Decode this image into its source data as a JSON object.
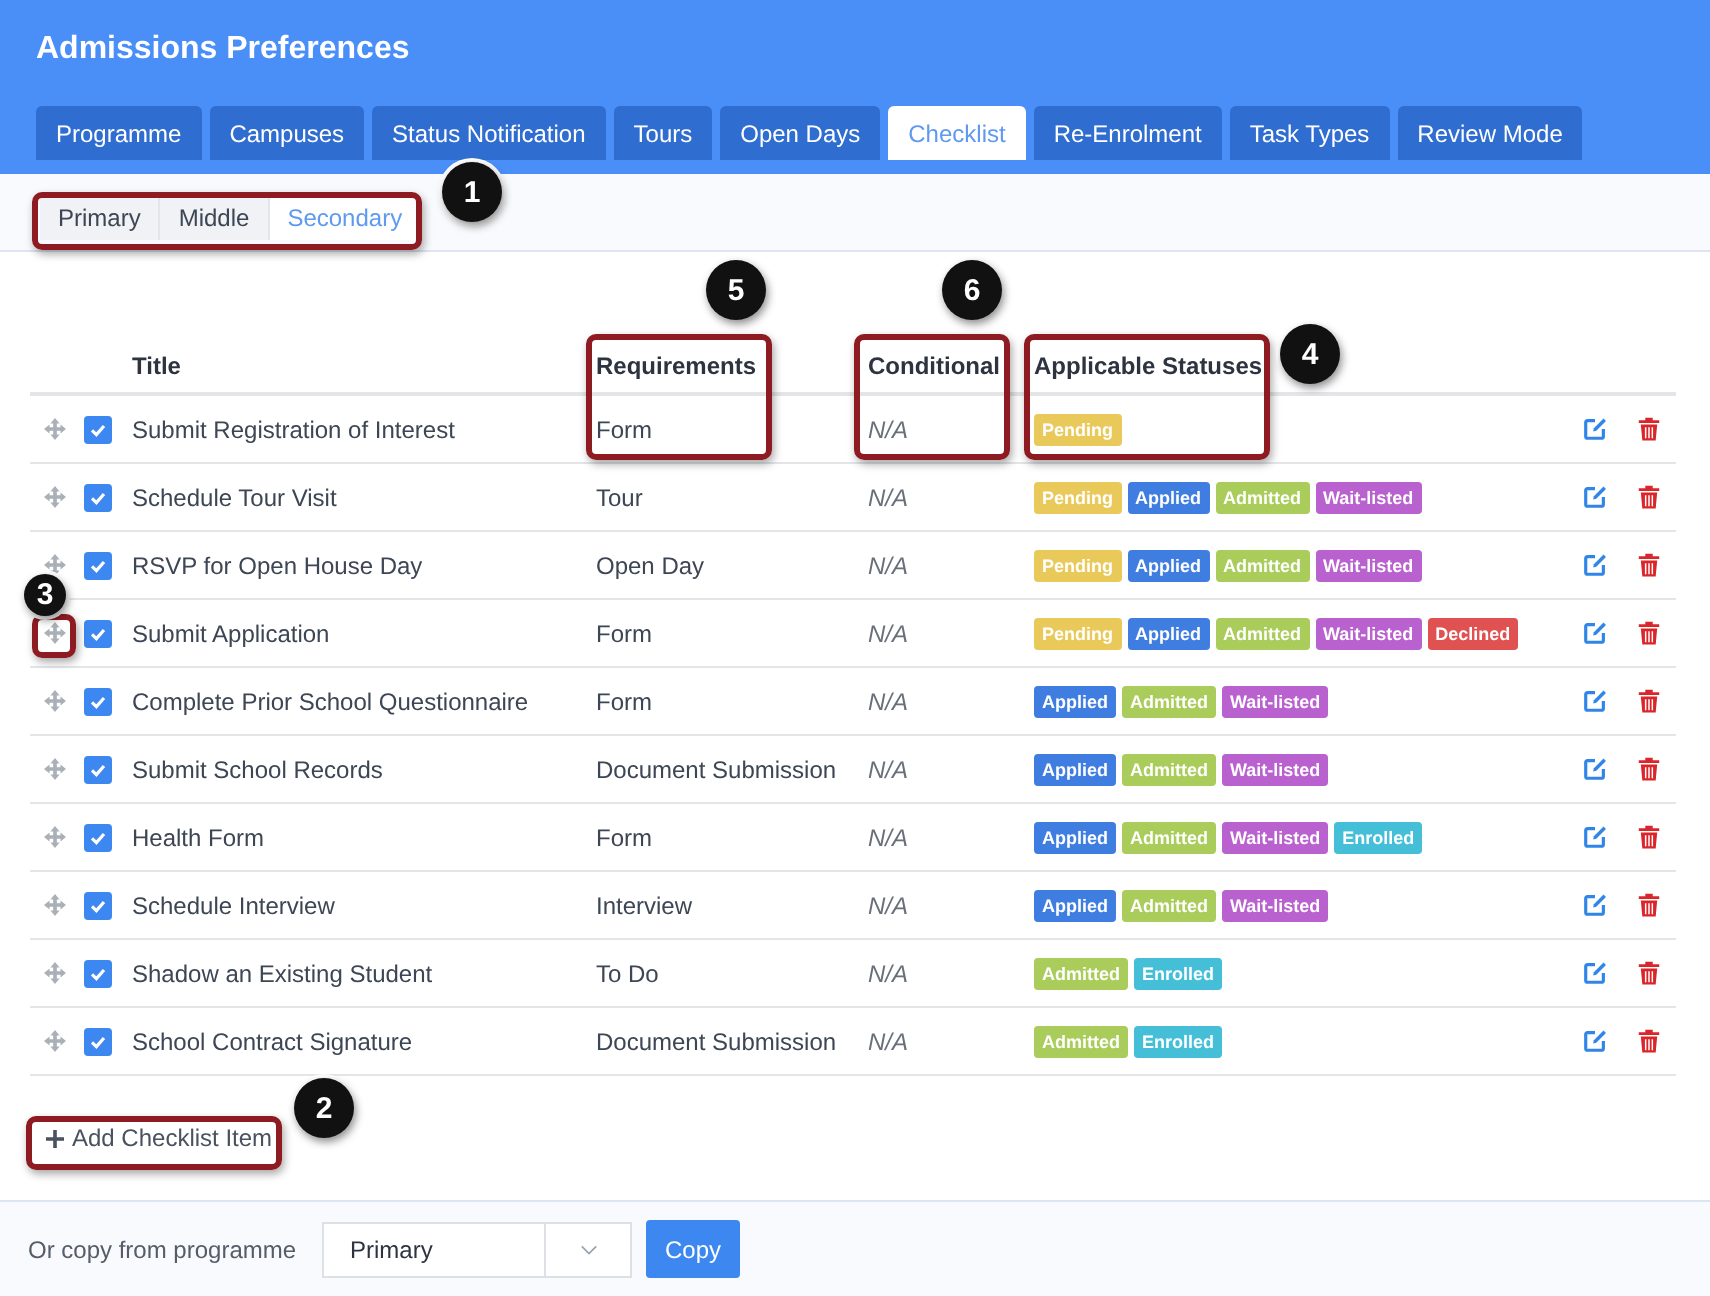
{
  "window": {
    "title": "Admissions Preferences"
  },
  "tabs": [
    {
      "label": "Programme",
      "selected": false
    },
    {
      "label": "Campuses",
      "selected": false
    },
    {
      "label": "Status Notification",
      "selected": false
    },
    {
      "label": "Tours",
      "selected": false
    },
    {
      "label": "Open Days",
      "selected": false
    },
    {
      "label": "Checklist",
      "selected": true
    },
    {
      "label": "Re-Enrolment",
      "selected": false
    },
    {
      "label": "Task Types",
      "selected": false
    },
    {
      "label": "Review Mode",
      "selected": false
    }
  ],
  "subtabs": [
    {
      "label": "Primary",
      "selected": false
    },
    {
      "label": "Middle",
      "selected": false
    },
    {
      "label": "Secondary",
      "selected": true
    }
  ],
  "table": {
    "columns": [
      "Title",
      "Requirements",
      "Conditional",
      "Applicable Statuses"
    ],
    "rows": [
      {
        "checked": true,
        "title": "Submit Registration of Interest",
        "requirements": "Form",
        "conditional": "N/A",
        "statuses": [
          {
            "label": "Pending",
            "color": "#e8c95a"
          }
        ]
      },
      {
        "checked": true,
        "title": "Schedule Tour Visit",
        "requirements": "Tour",
        "conditional": "N/A",
        "statuses": [
          {
            "label": "Pending",
            "color": "#e8c95a"
          },
          {
            "label": "Applied",
            "color": "#3f7ee0"
          },
          {
            "label": "Admitted",
            "color": "#a9cc5a"
          },
          {
            "label": "Wait-listed",
            "color": "#b961cf"
          }
        ]
      },
      {
        "checked": true,
        "title": "RSVP for Open House Day",
        "requirements": "Open Day",
        "conditional": "N/A",
        "statuses": [
          {
            "label": "Pending",
            "color": "#e8c95a"
          },
          {
            "label": "Applied",
            "color": "#3f7ee0"
          },
          {
            "label": "Admitted",
            "color": "#a9cc5a"
          },
          {
            "label": "Wait-listed",
            "color": "#b961cf"
          }
        ]
      },
      {
        "checked": true,
        "title": "Submit Application",
        "requirements": "Form",
        "conditional": "N/A",
        "statuses": [
          {
            "label": "Pending",
            "color": "#e8c95a"
          },
          {
            "label": "Applied",
            "color": "#3f7ee0"
          },
          {
            "label": "Admitted",
            "color": "#a9cc5a"
          },
          {
            "label": "Wait-listed",
            "color": "#b961cf"
          },
          {
            "label": "Declined",
            "color": "#e05252"
          }
        ]
      },
      {
        "checked": true,
        "title": "Complete Prior School Questionnaire",
        "requirements": "Form",
        "conditional": "N/A",
        "statuses": [
          {
            "label": "Applied",
            "color": "#3f7ee0"
          },
          {
            "label": "Admitted",
            "color": "#a9cc5a"
          },
          {
            "label": "Wait-listed",
            "color": "#b961cf"
          }
        ]
      },
      {
        "checked": true,
        "title": "Submit School Records",
        "requirements": "Document Submission",
        "conditional": "N/A",
        "statuses": [
          {
            "label": "Applied",
            "color": "#3f7ee0"
          },
          {
            "label": "Admitted",
            "color": "#a9cc5a"
          },
          {
            "label": "Wait-listed",
            "color": "#b961cf"
          }
        ]
      },
      {
        "checked": true,
        "title": "Health Form",
        "requirements": "Form",
        "conditional": "N/A",
        "statuses": [
          {
            "label": "Applied",
            "color": "#3f7ee0"
          },
          {
            "label": "Admitted",
            "color": "#a9cc5a"
          },
          {
            "label": "Wait-listed",
            "color": "#b961cf"
          },
          {
            "label": "Enrolled",
            "color": "#45bfd8"
          }
        ]
      },
      {
        "checked": true,
        "title": "Schedule Interview",
        "requirements": "Interview",
        "conditional": "N/A",
        "statuses": [
          {
            "label": "Applied",
            "color": "#3f7ee0"
          },
          {
            "label": "Admitted",
            "color": "#a9cc5a"
          },
          {
            "label": "Wait-listed",
            "color": "#b961cf"
          }
        ]
      },
      {
        "checked": true,
        "title": "Shadow an Existing Student",
        "requirements": "To Do",
        "conditional": "N/A",
        "statuses": [
          {
            "label": "Admitted",
            "color": "#a9cc5a"
          },
          {
            "label": "Enrolled",
            "color": "#45bfd8"
          }
        ]
      },
      {
        "checked": true,
        "title": "School Contract Signature",
        "requirements": "Document Submission",
        "conditional": "N/A",
        "statuses": [
          {
            "label": "Admitted",
            "color": "#a9cc5a"
          },
          {
            "label": "Enrolled",
            "color": "#45bfd8"
          }
        ]
      }
    ]
  },
  "add_button": "Add Checklist Item",
  "footer": {
    "label": "Or copy from programme",
    "select_value": "Primary",
    "copy_button": "Copy"
  },
  "callouts": [
    {
      "number": "1"
    },
    {
      "number": "2"
    },
    {
      "number": "3"
    },
    {
      "number": "4"
    },
    {
      "number": "5"
    },
    {
      "number": "6"
    }
  ]
}
